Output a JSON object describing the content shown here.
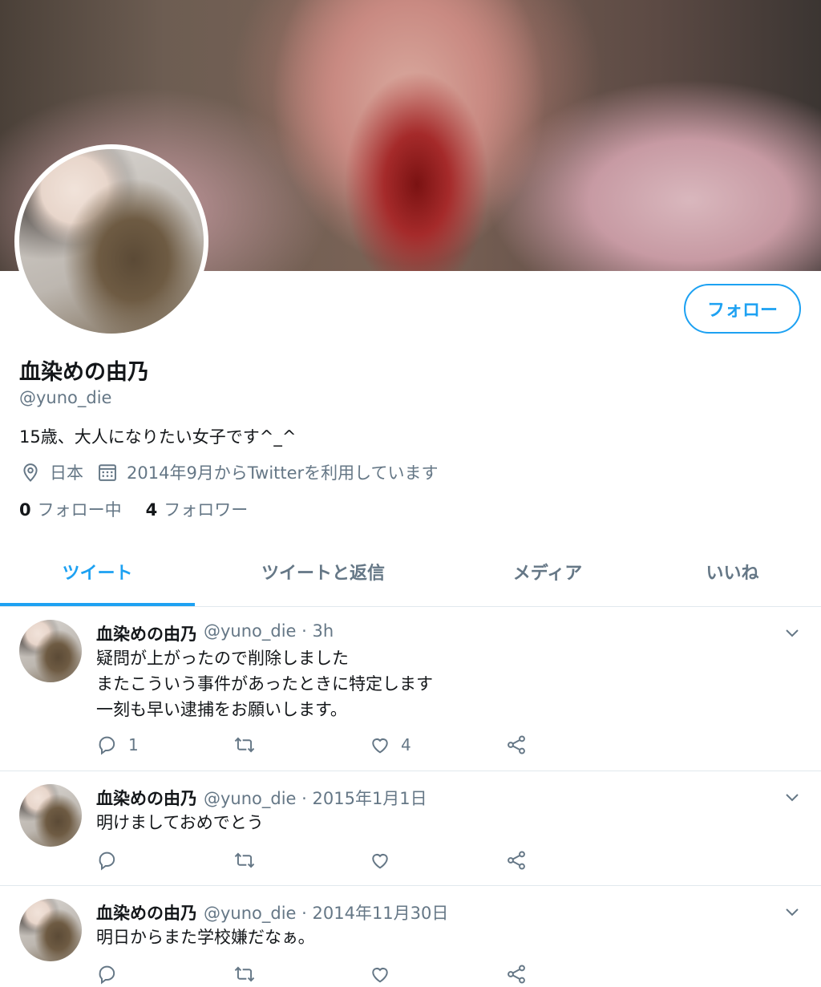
{
  "profile": {
    "name": "血染めの由乃",
    "handle": "@yuno_die",
    "bio": "15歳、大人になりたい女子です^_^",
    "location": "日本",
    "joined": "2014年9月からTwitterを利用しています",
    "following_count": "0",
    "following_label": "フォロー中",
    "followers_count": "4",
    "followers_label": "フォロワー",
    "follow_button": "フォロー"
  },
  "tabs": [
    {
      "label": "ツイート",
      "active": true
    },
    {
      "label": "ツイートと返信",
      "active": false
    },
    {
      "label": "メディア",
      "active": false
    },
    {
      "label": "いいね",
      "active": false
    }
  ],
  "tweets": [
    {
      "name": "血染めの由乃",
      "meta": "@yuno_die · 3h",
      "text": "疑問が上がったので削除しました\nまたこういう事件があったときに特定します\n一刻も早い逮捕をお願いします。",
      "replies": "1",
      "retweets": "",
      "likes": "4"
    },
    {
      "name": "血染めの由乃",
      "meta": "@yuno_die · 2015年1月1日",
      "text": "明けましておめでとう",
      "replies": "",
      "retweets": "",
      "likes": ""
    },
    {
      "name": "血染めの由乃",
      "meta": "@yuno_die · 2014年11月30日",
      "text": "明日からまた学校嫌だなぁ。",
      "replies": "",
      "retweets": "",
      "likes": ""
    }
  ],
  "colors": {
    "accent": "#1da1f2",
    "secondary_text": "#657786",
    "divider": "#e1e8ed"
  },
  "icons": [
    "location-icon",
    "calendar-icon",
    "reply-icon",
    "retweet-icon",
    "like-icon",
    "share-icon",
    "chevron-down-icon"
  ]
}
